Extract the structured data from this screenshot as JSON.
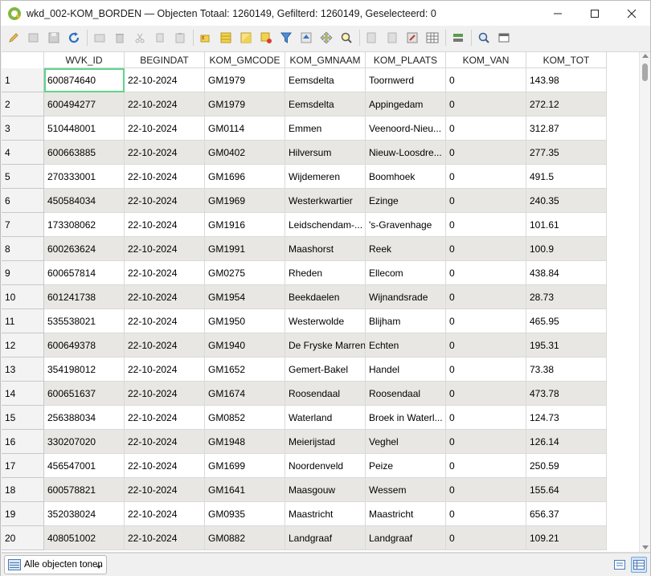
{
  "window": {
    "title": "wkd_002-KOM_BORDEN — Objecten Totaal: 1260149, Gefilterd: 1260149, Geselecteerd: 0",
    "minimize": "—",
    "maximize": "☐",
    "close": "✕"
  },
  "toolbar": {
    "icons": [
      "pencil-icon",
      "multi-edit-icon",
      "save-icon",
      "reload-icon",
      "add-feature-icon",
      "delete-icon",
      "cut-icon",
      "copy-icon",
      "paste-icon",
      "select-expression-icon",
      "select-all-icon",
      "invert-selection-icon",
      "deselect-icon",
      "filter-icon",
      "move-top-icon",
      "pan-icon",
      "zoom-selection-icon",
      "new-field-icon",
      "delete-field-icon",
      "field-calculator-icon",
      "conditional-format-icon",
      "actions-icon",
      "zoom-icon",
      "dock-icon"
    ]
  },
  "table": {
    "columns": [
      "WVK_ID",
      "BEGINDAT",
      "KOM_GMCODE",
      "KOM_GMNAAM",
      "KOM_PLAATS",
      "KOM_VAN",
      "KOM_TOT"
    ],
    "rows": [
      {
        "n": "1",
        "c": [
          "600874640",
          "22-10-2024",
          "GM1979",
          "Eemsdelta",
          "Toornwerd",
          "0",
          "143.98"
        ]
      },
      {
        "n": "2",
        "c": [
          "600494277",
          "22-10-2024",
          "GM1979",
          "Eemsdelta",
          "Appingedam",
          "0",
          "272.12"
        ]
      },
      {
        "n": "3",
        "c": [
          "510448001",
          "22-10-2024",
          "GM0114",
          "Emmen",
          "Veenoord-Nieu...",
          "0",
          "312.87"
        ]
      },
      {
        "n": "4",
        "c": [
          "600663885",
          "22-10-2024",
          "GM0402",
          "Hilversum",
          "Nieuw-Loosdre...",
          "0",
          "277.35"
        ]
      },
      {
        "n": "5",
        "c": [
          "270333001",
          "22-10-2024",
          "GM1696",
          "Wijdemeren",
          "Boomhoek",
          "0",
          "491.5"
        ]
      },
      {
        "n": "6",
        "c": [
          "450584034",
          "22-10-2024",
          "GM1969",
          "Westerkwartier",
          "Ezinge",
          "0",
          "240.35"
        ]
      },
      {
        "n": "7",
        "c": [
          "173308062",
          "22-10-2024",
          "GM1916",
          "Leidschendam-...",
          "'s-Gravenhage",
          "0",
          "101.61"
        ]
      },
      {
        "n": "8",
        "c": [
          "600263624",
          "22-10-2024",
          "GM1991",
          "Maashorst",
          "Reek",
          "0",
          "100.9"
        ]
      },
      {
        "n": "9",
        "c": [
          "600657814",
          "22-10-2024",
          "GM0275",
          "Rheden",
          "Ellecom",
          "0",
          "438.84"
        ]
      },
      {
        "n": "10",
        "c": [
          "601241738",
          "22-10-2024",
          "GM1954",
          "Beekdaelen",
          "Wijnandsrade",
          "0",
          "28.73"
        ]
      },
      {
        "n": "11",
        "c": [
          "535538021",
          "22-10-2024",
          "GM1950",
          "Westerwolde",
          "Blijham",
          "0",
          "465.95"
        ]
      },
      {
        "n": "12",
        "c": [
          "600649378",
          "22-10-2024",
          "GM1940",
          "De Fryske Marren",
          "Echten",
          "0",
          "195.31"
        ]
      },
      {
        "n": "13",
        "c": [
          "354198012",
          "22-10-2024",
          "GM1652",
          "Gemert-Bakel",
          "Handel",
          "0",
          "73.38"
        ]
      },
      {
        "n": "14",
        "c": [
          "600651637",
          "22-10-2024",
          "GM1674",
          "Roosendaal",
          "Roosendaal",
          "0",
          "473.78"
        ]
      },
      {
        "n": "15",
        "c": [
          "256388034",
          "22-10-2024",
          "GM0852",
          "Waterland",
          "Broek in Waterl...",
          "0",
          "124.73"
        ]
      },
      {
        "n": "16",
        "c": [
          "330207020",
          "22-10-2024",
          "GM1948",
          "Meierijstad",
          "Veghel",
          "0",
          "126.14"
        ]
      },
      {
        "n": "17",
        "c": [
          "456547001",
          "22-10-2024",
          "GM1699",
          "Noordenveld",
          "Peize",
          "0",
          "250.59"
        ]
      },
      {
        "n": "18",
        "c": [
          "600578821",
          "22-10-2024",
          "GM1641",
          "Maasgouw",
          "Wessem",
          "0",
          "155.64"
        ]
      },
      {
        "n": "19",
        "c": [
          "352038024",
          "22-10-2024",
          "GM0935",
          "Maastricht",
          "Maastricht",
          "0",
          "656.37"
        ]
      },
      {
        "n": "20",
        "c": [
          "408051002",
          "22-10-2024",
          "GM0882",
          "Landgraaf",
          "Landgraaf",
          "0",
          "109.21"
        ]
      }
    ]
  },
  "bottom": {
    "filter_label": "Alle objecten tonen"
  }
}
